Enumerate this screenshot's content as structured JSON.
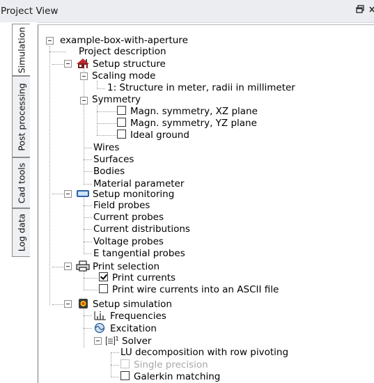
{
  "window": {
    "title": "Project View",
    "controls": [
      "restore-icon",
      "close-icon"
    ]
  },
  "tabs": [
    {
      "label": "Simulation",
      "active": true
    },
    {
      "label": "Post processing",
      "active": false
    },
    {
      "label": "Cad tools",
      "active": false
    },
    {
      "label": "Log data",
      "active": false
    }
  ],
  "tree": {
    "root": "example-box-with-aperture",
    "project_description": "Project description",
    "setup_structure": {
      "label": "Setup structure",
      "scaling_mode": "Scaling mode",
      "scaling_value": "1: Structure in meter, radii in millimeter",
      "symmetry": "Symmetry",
      "symmetry_items": [
        {
          "label": "Magn. symmetry, XZ plane",
          "checked": false
        },
        {
          "label": "Magn. symmetry, YZ plane",
          "checked": false
        },
        {
          "label": "Ideal ground",
          "checked": false
        }
      ],
      "wires": "Wires",
      "surfaces": "Surfaces",
      "bodies": "Bodies",
      "material": "Material parameter"
    },
    "setup_monitoring": {
      "label": "Setup monitoring",
      "field_probes": "Field probes",
      "current_probes": "Current probes",
      "current_distributions": "Current distributions",
      "voltage_probes": "Voltage probes",
      "e_tangential": "E tangential probes"
    },
    "print_selection": {
      "label": "Print selection",
      "print_currents": "Print currents",
      "print_currents_checked": true,
      "print_wire": "Print wire currents into an ASCII file",
      "print_wire_checked": false
    },
    "setup_simulation": {
      "label": "Setup simulation",
      "frequencies": "Frequencies",
      "excitation": "Excitation",
      "solver": "Solver",
      "lu": "LU decomposition with row pivoting",
      "single_precision": "Single precision",
      "single_precision_enabled": false,
      "galerkin": "Galerkin matching",
      "galerkin_checked": false
    }
  }
}
